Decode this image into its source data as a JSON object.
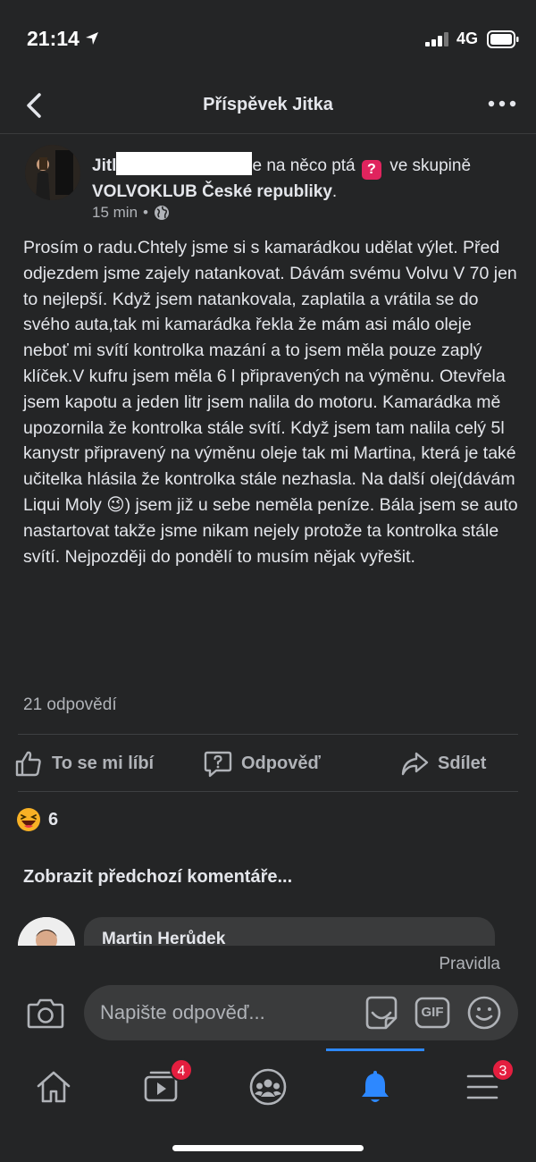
{
  "status": {
    "time": "21:14",
    "network": "4G"
  },
  "nav": {
    "title": "Příspěvek Jitka"
  },
  "post": {
    "author_visible": "Jitl",
    "author_tail": "e",
    "action_text": "na něco ptá",
    "in_text": "ve",
    "group_prefix": "skupině",
    "group_name": "VOLVOKLUB České republiky",
    "group_suffix": ".",
    "time": "15 min",
    "dot": "•",
    "body_part1": "Prosím o radu.Chtely jsme si s kamarádkou udělat výlet. Před odjezdem jsme zajely natankovat. Dávám svému Volvu V 70 jen to nejlepší. Když jsem natankovala, zaplatila a vrátila se do svého auta,tak mi kamarádka řekla že mám asi málo oleje neboť mi svítí kontrolka mazání a to jsem měla pouze zaplý klíček.V kufru jsem měla 6 l připravených na výměnu. Otevřela jsem kapotu a jeden litr jsem nalila do motoru. Kamarádka mě upozornila že kontrolka stále svítí. Když jsem tam nalila celý 5l kanystr připravený na výměnu oleje tak mi Martina, která je také učitelka hlásila že kontrolka stále nezhasla. Na další olej(dávám Liqui Moly",
    "body_emoji": "😉",
    "body_part2": ") jsem již u sebe neměla peníze. Bála jsem se auto nastartovat takže jsme nikam nejely protože ta kontrolka stále svítí. Nejpozději do pondělí to musím nějak vyřešit.",
    "replies": "21 odpovědí",
    "reaction_count": "6"
  },
  "actions": {
    "like": "To se mi líbí",
    "reply": "Odpověď",
    "share": "Sdílet"
  },
  "comments": {
    "show_previous": "Zobrazit předchozí komentáře...",
    "first_author": "Martin Herůdek"
  },
  "compose": {
    "rules": "Pravidla",
    "placeholder": "Napište odpověď...",
    "gif": "GIF"
  },
  "tabs": {
    "watch_badge": "4",
    "menu_badge": "3",
    "active": "notifications"
  },
  "colors": {
    "background": "#242526",
    "accent": "#2d88ff",
    "badge": "#e41e3f"
  }
}
